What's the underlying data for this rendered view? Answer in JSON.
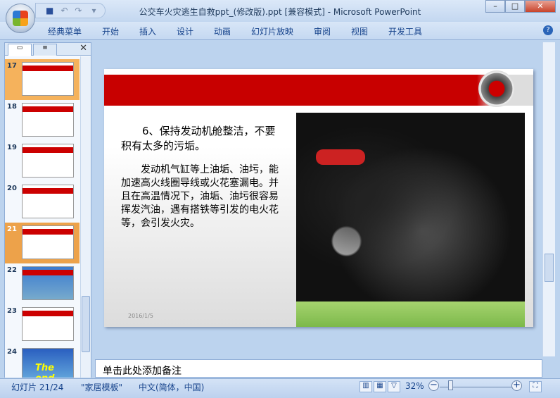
{
  "window": {
    "title": "公交车火灾逃生自救ppt_(修改版).ppt [兼容模式] - Microsoft PowerPoint",
    "minimize": "–",
    "maximize": "□",
    "close": "✕"
  },
  "ribbon": {
    "tabs": [
      "经典菜单",
      "开始",
      "插入",
      "设计",
      "动画",
      "幻灯片放映",
      "审阅",
      "视图",
      "开发工具"
    ],
    "help": "?"
  },
  "panel": {
    "close": "✕",
    "thumbnails": [
      {
        "num": "17"
      },
      {
        "num": "18"
      },
      {
        "num": "19"
      },
      {
        "num": "20"
      },
      {
        "num": "21"
      },
      {
        "num": "22"
      },
      {
        "num": "23"
      },
      {
        "num": "24",
        "text": "The end"
      }
    ],
    "selected": "21"
  },
  "slide": {
    "heading": "6、保持发动机舱整洁，不要积有太多的污垢。",
    "body": "发动机气缸等上油垢、油圬，能加速高火线圈导线或火花塞漏电。并且在高温情况下，油垢、油圬很容易挥发汽油，遇有搭铁等引发的电火花等，会引发火灾。",
    "date": "2016/1/5"
  },
  "notes": {
    "placeholder": "单击此处添加备注"
  },
  "status": {
    "slide": "幻灯片 21/24",
    "theme": "\"家居模板\"",
    "language": "中文(简体，中国)",
    "zoom": "32%",
    "zoom_level": 32
  },
  "colors": {
    "accent": "#c80000",
    "ribbon": "#c4d8f1"
  }
}
